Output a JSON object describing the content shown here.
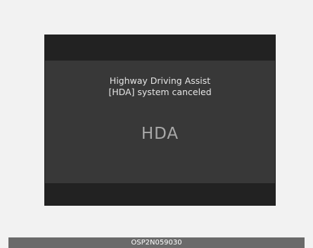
{
  "display": {
    "message_line1": "Highway Driving Assist",
    "message_line2": "[HDA] system canceled",
    "indicator": "HDA"
  },
  "caption": {
    "code": "OSP2N059030"
  },
  "colors": {
    "page_background": "#f2f2f2",
    "display_background": "#383838",
    "bar_background": "#222222",
    "message_text": "#e6e6e6",
    "indicator_text": "#a8a8a8",
    "caption_background": "#6a6a6a"
  }
}
